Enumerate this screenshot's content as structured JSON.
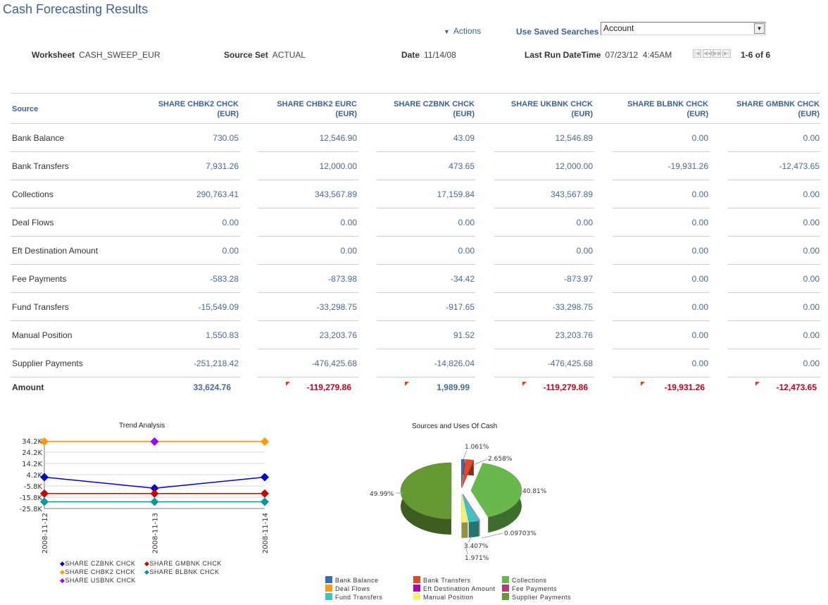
{
  "page": {
    "title": "Cash Forecasting Results",
    "actions_label": "Actions",
    "saved_searches_label": "Use Saved Searches",
    "saved_searches_value": "Account"
  },
  "info": {
    "worksheet_label": "Worksheet",
    "worksheet_value": "CASH_SWEEP_EUR",
    "source_set_label": "Source Set",
    "source_set_value": "ACTUAL",
    "date_label": "Date",
    "date_value": "11/14/08",
    "last_run_label": "Last Run DateTime",
    "last_run_value": "07/23/12  4:45AM",
    "pagination": "1-6 of 6",
    "nav_icons": [
      "first-page-icon",
      "previous-page-icon",
      "next-page-icon",
      "last-page-icon"
    ]
  },
  "table": {
    "source_header": "Source",
    "columns": [
      {
        "line1": "SHARE CHBK2 CHCK",
        "line2": "(EUR)"
      },
      {
        "line1": "SHARE CHBK2 EURC",
        "line2": "(EUR)"
      },
      {
        "line1": "SHARE CZBNK CHCK",
        "line2": "(EUR)"
      },
      {
        "line1": "SHARE UKBNK CHCK",
        "line2": "(EUR)"
      },
      {
        "line1": "SHARE BLBNK CHCK",
        "line2": "(EUR)"
      },
      {
        "line1": "SHARE GMBNK CHCK",
        "line2": "(EUR)"
      }
    ],
    "rows": [
      {
        "source": "Bank Balance",
        "values": [
          "730.05",
          "12,546.90",
          "43.09",
          "12,546.89",
          "0.00",
          "0.00"
        ]
      },
      {
        "source": "Bank Transfers",
        "values": [
          "7,931.26",
          "12,000.00",
          "473.65",
          "12,000.00",
          "-19,931.26",
          "-12,473.65"
        ]
      },
      {
        "source": "Collections",
        "values": [
          "290,763.41",
          "343,567.89",
          "17,159.84",
          "343,567.89",
          "0.00",
          "0.00"
        ]
      },
      {
        "source": "Deal Flows",
        "values": [
          "0.00",
          "0.00",
          "0.00",
          "0.00",
          "0.00",
          "0.00"
        ]
      },
      {
        "source": "Eft Destination Amount",
        "values": [
          "0.00",
          "0.00",
          "0.00",
          "0.00",
          "0.00",
          "0.00"
        ]
      },
      {
        "source": "Fee Payments",
        "values": [
          "-583.28",
          "-873.98",
          "-34.42",
          "-873.97",
          "0.00",
          "0.00"
        ]
      },
      {
        "source": "Fund Transfers",
        "values": [
          "-15,549.09",
          "-33,298.75",
          "-917.65",
          "-33,298.75",
          "0.00",
          "0.00"
        ]
      },
      {
        "source": "Manual Position",
        "values": [
          "1,550.83",
          "23,203.76",
          "91.52",
          "23,203.76",
          "0.00",
          "0.00"
        ]
      },
      {
        "source": "Supplier Payments",
        "values": [
          "-251,218.42",
          "-476,425.68",
          "-14,826.04",
          "-476,425.68",
          "0.00",
          "0.00"
        ]
      }
    ],
    "amount": {
      "label": "Amount",
      "values": [
        "33,624.76",
        "-119,279.86",
        "1,989.99",
        "-119,279.86",
        "-19,931.26",
        "-12,473.65"
      ],
      "flagged": [
        false,
        true,
        true,
        true,
        true,
        true
      ]
    }
  },
  "colors": {
    "title": "#3f6294",
    "link": "#3c6296",
    "negative": "#c4001f",
    "flag": "#d9431c"
  },
  "chart_data": [
    {
      "type": "line",
      "title": "Trend Analysis",
      "x": [
        "2008-11-12",
        "2008-11-13",
        "2008-11-14"
      ],
      "ylim": [
        -25.8,
        34.2
      ],
      "yticks": [
        "34.2K",
        "24.2K",
        "14.2K",
        "4.2K",
        "-5.8K",
        "-15.8K",
        "-25.8K"
      ],
      "ytick_values": [
        34.2,
        24.2,
        14.2,
        4.2,
        -5.8,
        -15.8,
        -25.8
      ],
      "grid": true,
      "legend_position": "bottom",
      "series": [
        {
          "name": "SHARE CZBNK CHCK",
          "color": "#0000cc",
          "values": [
            2.0,
            -7.8,
            2.0
          ]
        },
        {
          "name": "SHARE GMBNK CHCK",
          "color": "#cc0000",
          "values": [
            -12.5,
            -12.5,
            -12.5
          ]
        },
        {
          "name": "SHARE CHBK2 CHCK",
          "color": "#ff9900",
          "values": [
            33.6,
            33.6,
            33.6
          ]
        },
        {
          "name": "SHARE BLBNK CHCK",
          "color": "#009999",
          "values": [
            -19.9,
            -19.9,
            -19.9
          ]
        },
        {
          "name": "SHARE USBNK CHCK",
          "color": "#9900ff",
          "values": [
            null,
            33.6,
            null
          ]
        }
      ]
    },
    {
      "type": "pie",
      "title": "Sources and Uses Of Cash",
      "legend_position": "bottom",
      "slices": [
        {
          "label": "Bank Balance",
          "value": 1.061,
          "color": "#3b6db5",
          "text": "1.061%"
        },
        {
          "label": "Bank Transfers",
          "value": 2.658,
          "color": "#e0492a",
          "text": "2.658%"
        },
        {
          "label": "Collections",
          "value": 40.81,
          "color": "#68b84c",
          "text": "40.81%"
        },
        {
          "label": "Deal Flows",
          "value": 0,
          "color": "#ff9a14",
          "text": ""
        },
        {
          "label": "Eft Destination Amount",
          "value": 0,
          "color": "#b100b8",
          "text": ""
        },
        {
          "label": "Fee Payments",
          "value": 0.09703,
          "color": "#b83a6e",
          "text": "0.09703%"
        },
        {
          "label": "Fund Transfers",
          "value": 3.407,
          "color": "#3ec2c2",
          "text": "3.407%"
        },
        {
          "label": "Manual Position",
          "value": 1.971,
          "color": "#f8ef6a",
          "text": "1.971%"
        },
        {
          "label": "Supplier Payments",
          "value": 49.99,
          "color": "#669933",
          "text": "49.99%"
        }
      ]
    }
  ]
}
